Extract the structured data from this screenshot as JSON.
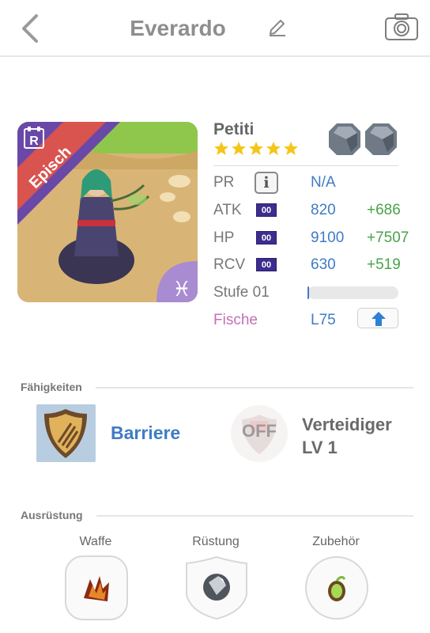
{
  "header": {
    "title": "Everardo",
    "back_icon": "chevron-left-icon",
    "edit_icon": "pencil-icon",
    "camera_icon": "camera-icon"
  },
  "monster": {
    "rarity_letter": "R",
    "ribbon": "Episch",
    "name": "Petiti",
    "stars": 5,
    "element_symbol": "♓",
    "awakenings": 2
  },
  "stats": {
    "pr": {
      "label": "PR",
      "value": "N/A"
    },
    "atk": {
      "label": "ATK",
      "badge": "00",
      "value": "820",
      "plus": "+686"
    },
    "hp": {
      "label": "HP",
      "badge": "00",
      "value": "9100",
      "plus": "+7507"
    },
    "rcv": {
      "label": "RCV",
      "badge": "00",
      "value": "630",
      "plus": "+519"
    },
    "level": {
      "label": "Stufe 01",
      "progress": 0.02
    },
    "type": {
      "label": "Fische",
      "value": "L75"
    }
  },
  "skills": {
    "section_title": "Fähigkeiten",
    "active_name": "Barriere",
    "leader_state": "OFF",
    "leader_name_line1": "Verteidiger",
    "leader_name_line2": "LV 1"
  },
  "equipment": {
    "section_title": "Ausrüstung",
    "weapon_label": "Waffe",
    "armor_label": "Rüstung",
    "accessory_label": "Zubehör"
  },
  "colors": {
    "accent_blue": "#3f7cc4",
    "bonus_green": "#4aa24a",
    "type_pink": "#c46fb5",
    "star_gold": "#f5c518",
    "ribbon_red": "#d9534f"
  }
}
